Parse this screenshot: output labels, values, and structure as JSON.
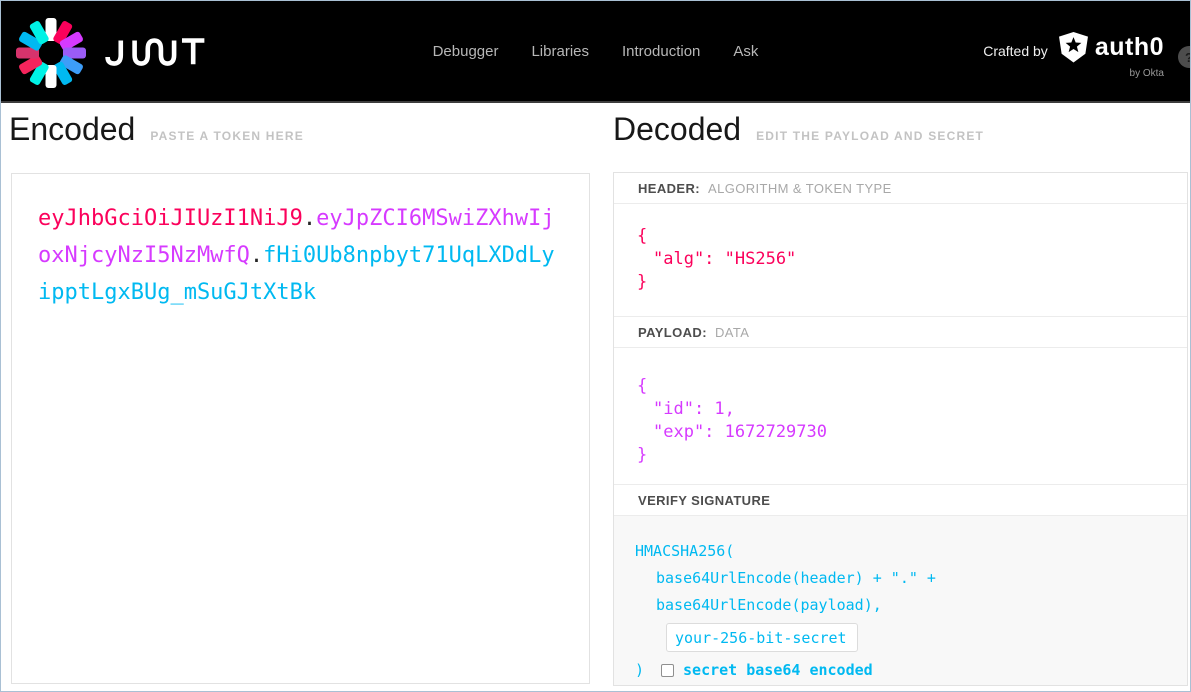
{
  "header": {
    "brand": "JWT",
    "nav": [
      {
        "label": "Debugger"
      },
      {
        "label": "Libraries"
      },
      {
        "label": "Introduction"
      },
      {
        "label": "Ask"
      }
    ],
    "crafted_by": "Crafted by",
    "auth0_brand": "auth0",
    "by_okta": "by Okta",
    "help": "?"
  },
  "encoded": {
    "title": "Encoded",
    "subtitle": "PASTE A TOKEN HERE",
    "token": {
      "header_segment": "eyJhbGciOiJIUzI1NiJ9",
      "separator": ".",
      "payload_segment": "eyJpZCI6MSwiZXhwIjoxNjcyNzI5NzMwfQ",
      "signature_segment": "fHi0Ub8npbyt71UqLXDdLyipptLgxBUg_mSuGJtXtBk"
    }
  },
  "decoded": {
    "title": "Decoded",
    "subtitle": "EDIT THE PAYLOAD AND SECRET",
    "header_section": {
      "label": "HEADER:",
      "hint": "ALGORITHM & TOKEN TYPE",
      "json_lines": [
        "{",
        "\"alg\": \"HS256\"",
        "}"
      ]
    },
    "payload_section": {
      "label": "PAYLOAD:",
      "hint": "DATA",
      "json_lines": [
        "{",
        "\"id\": 1,",
        "\"exp\": 1672729730",
        "}"
      ]
    },
    "signature_section": {
      "label": "VERIFY SIGNATURE",
      "code_line1": "HMACSHA256(",
      "code_line2": "base64UrlEncode(header) + \".\" +",
      "code_line3": "base64UrlEncode(payload),",
      "secret_value": "your-256-bit-secret",
      "close_paren": ")",
      "checkbox_label": "secret base64 encoded"
    }
  },
  "colors": {
    "token_header": "#fb015b",
    "token_payload": "#d63aff",
    "token_signature": "#00b9f1",
    "topbar_bg": "#000000"
  }
}
